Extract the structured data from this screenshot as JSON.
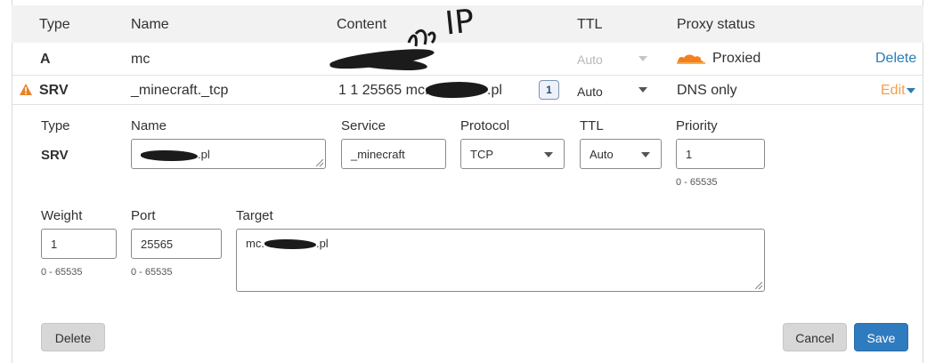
{
  "columns": {
    "type": "Type",
    "name": "Name",
    "content": "Content",
    "ttl": "TTL",
    "proxy": "Proxy status"
  },
  "annotation": "IP",
  "records": [
    {
      "type": "A",
      "name": "mc",
      "content": "",
      "ttl": "Auto",
      "proxy_status": "Proxied",
      "action": "Delete"
    },
    {
      "type": "SRV",
      "name": "_minecraft._tcp",
      "content": "1 1 25565 mc.",
      "content_suffix": ".pl",
      "priority_badge": "1",
      "ttl": "Auto",
      "proxy_status": "DNS only",
      "action": "Edit"
    }
  ],
  "edit_form": {
    "type_label": "Type",
    "type_value": "SRV",
    "name_label": "Name",
    "name_value": ".pl",
    "service_label": "Service",
    "service_value": "_minecraft",
    "protocol_label": "Protocol",
    "protocol_value": "TCP",
    "ttl_label": "TTL",
    "ttl_value": "Auto",
    "priority_label": "Priority",
    "priority_value": "1",
    "priority_hint": "0 - 65535",
    "weight_label": "Weight",
    "weight_value": "1",
    "weight_hint": "0 - 65535",
    "port_label": "Port",
    "port_value": "25565",
    "port_hint": "0 - 65535",
    "target_label": "Target",
    "target_prefix": "mc.",
    "target_suffix": ".pl",
    "delete_label": "Delete",
    "cancel_label": "Cancel",
    "save_label": "Save"
  },
  "colors": {
    "header_bg": "#f2f2f2",
    "link": "#2c7cb0",
    "edit": "#f5a04a",
    "cloud": "#f38020",
    "warning": "#e8832a",
    "save_bg": "#2f7bbf"
  }
}
